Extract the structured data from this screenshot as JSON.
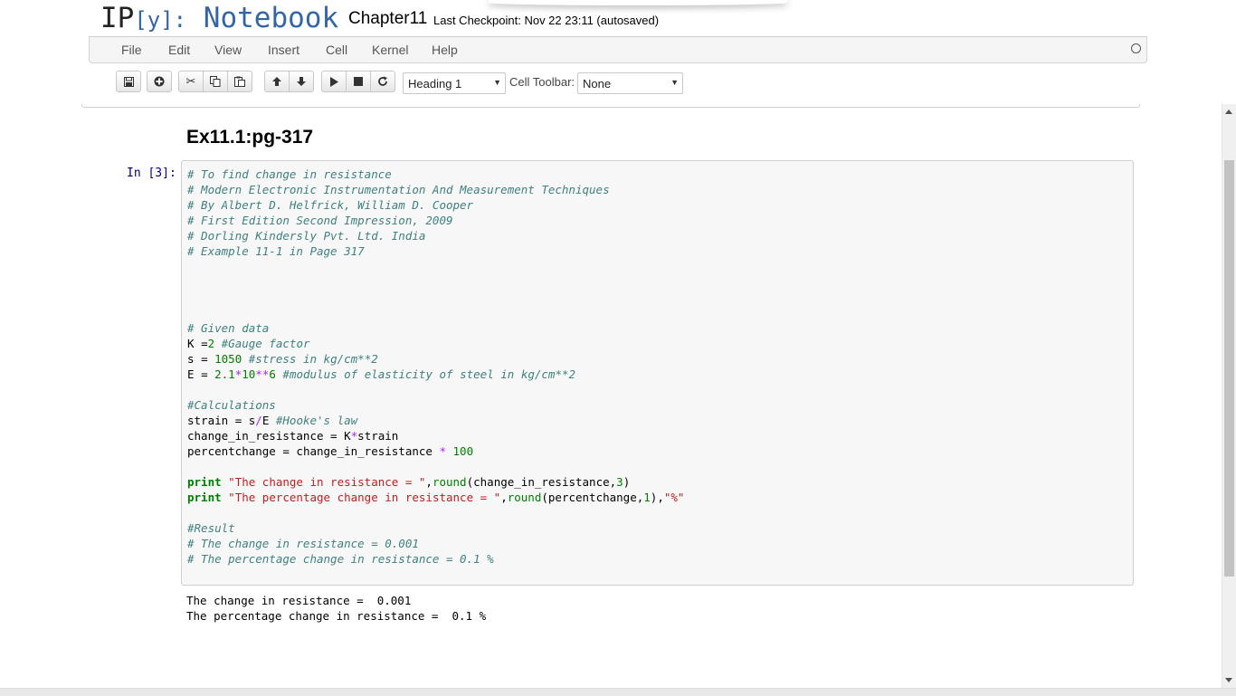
{
  "header": {
    "logo_ip": "IP",
    "logo_y": "[y]:",
    "logo_notebook": "Notebook",
    "notebook_name": "Chapter11",
    "checkpoint": "Last Checkpoint: Nov 22 23:11 (autosaved)"
  },
  "menubar": {
    "items": [
      "File",
      "Edit",
      "View",
      "Insert",
      "Cell",
      "Kernel",
      "Help"
    ],
    "kernel_indicator": "circle-icon"
  },
  "toolbar": {
    "buttons": [
      {
        "name": "save-icon",
        "glyph": "🖫"
      },
      {
        "name": "insert-cell-icon",
        "glyph": "⊕"
      },
      {
        "name": "cut-icon",
        "glyph": "✂"
      },
      {
        "name": "copy-icon",
        "glyph": "⧉"
      },
      {
        "name": "paste-icon",
        "glyph": "📋"
      },
      {
        "name": "move-up-icon",
        "glyph": "⬆"
      },
      {
        "name": "move-down-icon",
        "glyph": "⬇"
      },
      {
        "name": "run-icon",
        "glyph": "▶"
      },
      {
        "name": "stop-icon",
        "glyph": "■"
      },
      {
        "name": "restart-icon",
        "glyph": "↻"
      }
    ],
    "cell_type_value": "Heading 1",
    "cell_toolbar_label": "Cell Toolbar:",
    "cell_toolbar_value": "None"
  },
  "cells": {
    "heading": "Ex11.1:pg-317",
    "prompt": "In [3]:",
    "code_lines": [
      "# To find change in resistance",
      "# Modern Electronic Instrumentation And Measurement Techniques",
      "# By Albert D. Helfrick, William D. Cooper",
      "# First Edition Second Impression, 2009",
      "# Dorling Kindersly Pvt. Ltd. India",
      "# Example 11-1 in Page 317",
      "",
      "",
      "",
      "",
      "# Given data",
      "K =2 #Gauge factor",
      "s = 1050 #stress in kg/cm**2",
      "E = 2.1*10**6 #modulus of elasticity of steel in kg/cm**2",
      "",
      "#Calculations",
      "strain = s/E #Hooke's law",
      "change_in_resistance = K*strain",
      "percentchange = change_in_resistance * 100",
      "",
      "print \"The change in resistance = \",round(change_in_resistance,3)",
      "print \"The percentage change in resistance = \",round(percentchange,1),\"%\"",
      "",
      "#Result",
      "# The change in resistance = 0.001",
      "# The percentage change in resistance = 0.1 %"
    ],
    "output_lines": [
      "The change in resistance =  0.001",
      "The percentage change in resistance =  0.1 %"
    ]
  },
  "colors": {
    "logo_blue": "#3465a4",
    "comment": "#408080",
    "number": "#008000",
    "operator": "#aa22ff",
    "keyword": "#008000",
    "string": "#ba2121",
    "prompt": "#000080"
  }
}
